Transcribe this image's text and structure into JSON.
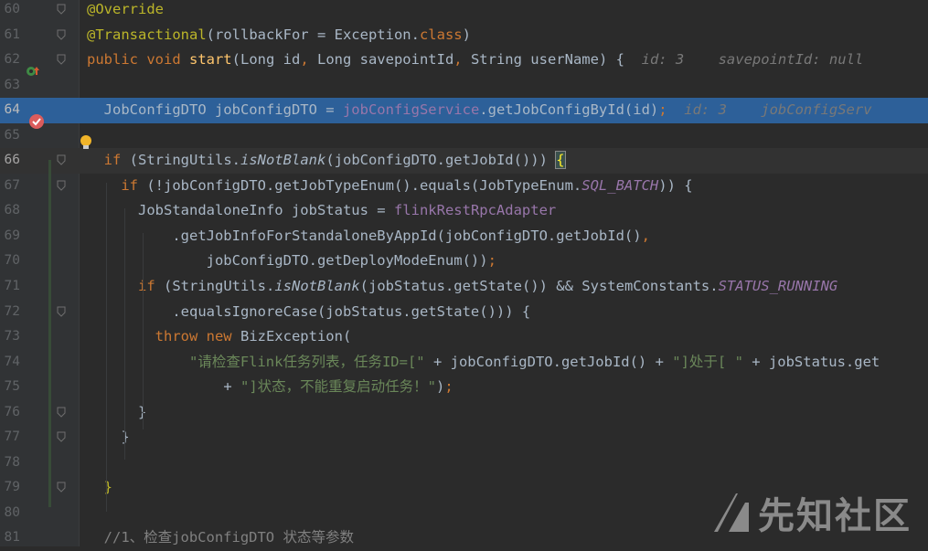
{
  "editor": {
    "lines": [
      {
        "num": "60",
        "tokens": [
          {
            "t": "@Override",
            "c": "ann"
          }
        ]
      },
      {
        "num": "61",
        "tokens": [
          {
            "t": "@Transactional",
            "c": "ann"
          },
          {
            "t": "(rollbackFor = Exception."
          },
          {
            "t": "class",
            "c": "kw"
          },
          {
            "t": ")"
          }
        ]
      },
      {
        "num": "62",
        "tokens": [
          {
            "t": "public void ",
            "c": "kw"
          },
          {
            "t": "start",
            "c": "fn"
          },
          {
            "t": "(Long id"
          },
          {
            "t": ", ",
            "c": "kw"
          },
          {
            "t": "Long savepointId"
          },
          {
            "t": ", ",
            "c": "kw"
          },
          {
            "t": "String userName) {  "
          },
          {
            "t": "id: 3    savepointId: null",
            "c": "inlay"
          }
        ]
      },
      {
        "num": "63",
        "tokens": []
      },
      {
        "num": "64",
        "tokens": [
          {
            "t": "  JobConfigDTO jobConfigDTO = "
          },
          {
            "t": "jobConfigService",
            "c": "fld"
          },
          {
            "t": ".getJobConfigById(id)"
          },
          {
            "t": ";",
            "c": "kw"
          },
          {
            "t": "  id: 3    jobConfigServ",
            "c": "inlay"
          }
        ]
      },
      {
        "num": "65",
        "tokens": []
      },
      {
        "num": "66",
        "tokens": [
          {
            "t": "  "
          },
          {
            "t": "if ",
            "c": "kw"
          },
          {
            "t": "(StringUtils."
          },
          {
            "t": "isNotBlank",
            "c": "ital"
          },
          {
            "t": "(jobConfigDTO.getJobId())) "
          },
          {
            "t": "{",
            "c": "brace-hl"
          }
        ]
      },
      {
        "num": "67",
        "tokens": [
          {
            "t": "    "
          },
          {
            "t": "if ",
            "c": "kw"
          },
          {
            "t": "(!jobConfigDTO.getJobTypeEnum().equals(JobTypeEnum."
          },
          {
            "t": "SQL_BATCH",
            "c": "fld ital"
          },
          {
            "t": ")) {"
          }
        ]
      },
      {
        "num": "68",
        "tokens": [
          {
            "t": "      JobStandaloneInfo jobStatus = "
          },
          {
            "t": "flinkRestRpcAdapter",
            "c": "fld"
          }
        ]
      },
      {
        "num": "69",
        "tokens": [
          {
            "t": "          .getJobInfoForStandaloneByAppId(jobConfigDTO.getJobId()"
          },
          {
            "t": ",",
            "c": "kw"
          }
        ]
      },
      {
        "num": "70",
        "tokens": [
          {
            "t": "              jobConfigDTO.getDeployModeEnum())"
          },
          {
            "t": ";",
            "c": "kw"
          }
        ]
      },
      {
        "num": "71",
        "tokens": [
          {
            "t": "      "
          },
          {
            "t": "if ",
            "c": "kw"
          },
          {
            "t": "(StringUtils."
          },
          {
            "t": "isNotBlank",
            "c": "ital"
          },
          {
            "t": "(jobStatus.getState()) && SystemConstants."
          },
          {
            "t": "STATUS_RUNNING",
            "c": "fld ital"
          }
        ]
      },
      {
        "num": "72",
        "tokens": [
          {
            "t": "          .equalsIgnoreCase(jobStatus.getState())) {"
          }
        ]
      },
      {
        "num": "73",
        "tokens": [
          {
            "t": "        "
          },
          {
            "t": "throw new ",
            "c": "kw"
          },
          {
            "t": "BizException("
          }
        ]
      },
      {
        "num": "74",
        "tokens": [
          {
            "t": "            "
          },
          {
            "t": "\"请检查Flink任务列表，任务ID=[\"",
            "c": "str"
          },
          {
            "t": " + jobConfigDTO.getJobId() + "
          },
          {
            "t": "\"]处于[ \"",
            "c": "str"
          },
          {
            "t": " + jobStatus.get"
          }
        ]
      },
      {
        "num": "75",
        "tokens": [
          {
            "t": "                "
          },
          {
            "t": "+ "
          },
          {
            "t": "\"]状态，不能重复启动任务！\"",
            "c": "str"
          },
          {
            "t": ")"
          },
          {
            "t": ";",
            "c": "kw"
          }
        ]
      },
      {
        "num": "76",
        "tokens": [
          {
            "t": "      }"
          }
        ]
      },
      {
        "num": "77",
        "tokens": [
          {
            "t": "    }"
          }
        ]
      },
      {
        "num": "78",
        "tokens": []
      },
      {
        "num": "79",
        "tokens": [
          {
            "t": "  "
          },
          {
            "t": "}",
            "c": "ann"
          }
        ]
      },
      {
        "num": "80",
        "tokens": []
      },
      {
        "num": "81",
        "tokens": [
          {
            "t": "  //1、检查jobConfigDTO 状态等参数",
            "c": "cmt"
          }
        ]
      }
    ],
    "highlight_line": "64",
    "current_line": "66"
  },
  "watermark": {
    "text": "先知社区"
  },
  "colors": {
    "background": "#2b2b2b",
    "keyword": "#cc7832",
    "string": "#6a8759",
    "field": "#9876aa",
    "annotation": "#bbb529",
    "method": "#ffc66d",
    "selection": "#2d6099"
  }
}
